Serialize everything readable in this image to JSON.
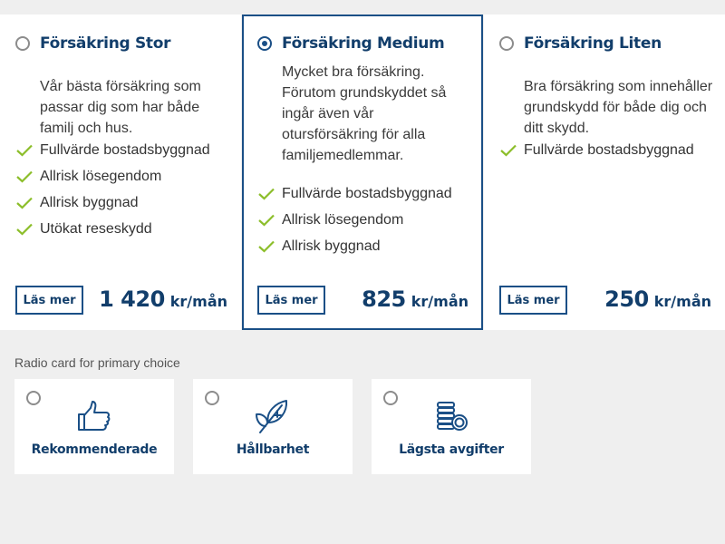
{
  "cards": [
    {
      "title": "Försäkring Stor",
      "selected": false,
      "description": "Vår bästa försäkring som passar dig som har både familj och hus.",
      "features": [
        "Fullvärde bostadsbyggnad",
        "Allrisk lösegendom",
        "Allrisk byggnad",
        "Utökat reseskydd"
      ],
      "button_label": "Läs mer",
      "price": "1 420",
      "price_unit": "kr/mån"
    },
    {
      "title": "Försäkring Medium",
      "selected": true,
      "description": "Mycket bra försäkring. Förutom grundskyddet så ingår även vår otursförsäkring för alla familjemedlemmar.",
      "features": [
        "Fullvärde bostadsbyggnad",
        "Allrisk lösegendom",
        "Allrisk byggnad"
      ],
      "button_label": "Läs mer",
      "price": "825",
      "price_unit": "kr/mån"
    },
    {
      "title": "Försäkring Liten",
      "selected": false,
      "description": "Bra försäkring som innehåller grundskydd för både dig och ditt skydd.",
      "features": [
        "Fullvärde bostadsbyggnad"
      ],
      "button_label": "Läs mer",
      "price": "250",
      "price_unit": "kr/mån"
    }
  ],
  "radio_section": {
    "label": "Radio card for primary choice",
    "options": [
      {
        "label": "Rekommenderade",
        "icon": "thumbs-up-icon",
        "selected": false
      },
      {
        "label": "Hållbarhet",
        "icon": "leaf-icon",
        "selected": false
      },
      {
        "label": "Lägsta avgifter",
        "icon": "coins-icon",
        "selected": false
      }
    ]
  },
  "colors": {
    "primary": "#123e6b",
    "border_selected": "#1a4f86",
    "check": "#8cbe2a",
    "background": "#efefef"
  }
}
